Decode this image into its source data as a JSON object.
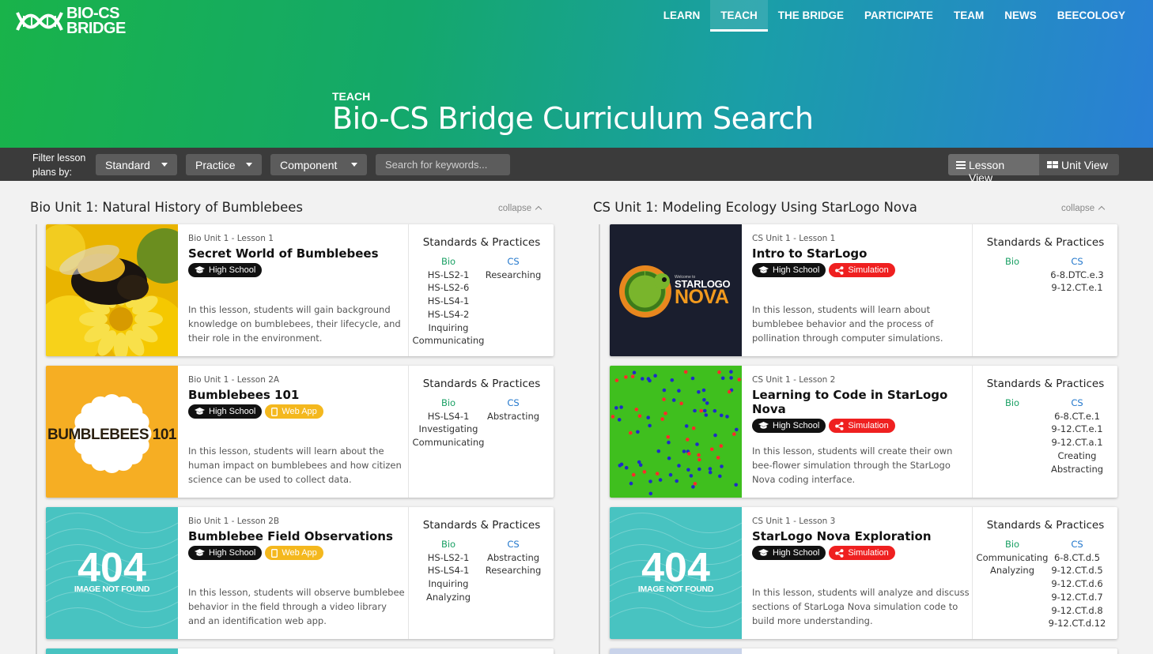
{
  "brand": {
    "logo_text_line1": "BIO-CS",
    "logo_text_line2": "BRIDGE"
  },
  "nav": [
    {
      "label": "LEARN",
      "active": false
    },
    {
      "label": "TEACH",
      "active": true
    },
    {
      "label": "THE BRIDGE",
      "active": false
    },
    {
      "label": "PARTICIPATE",
      "active": false
    },
    {
      "label": "TEAM",
      "active": false
    },
    {
      "label": "NEWS",
      "active": false
    },
    {
      "label": "BEECOLOGY",
      "active": false
    }
  ],
  "hero": {
    "kicker": "TEACH",
    "title": "Bio-CS Bridge Curriculum Search"
  },
  "filter": {
    "label_line1": "Filter lesson",
    "label_line2": "plans by:",
    "standard": "Standard",
    "practice": "Practice",
    "component": "Component",
    "search_placeholder": "Search for keywords...",
    "lesson_view": "Lesson View",
    "unit_view": "Unit View"
  },
  "columns": [
    {
      "heading": "Bio Unit 1: Natural History of Bumblebees",
      "collapse": "collapse",
      "cards": [
        {
          "image": "bumblebee-on-flower",
          "kicker": "Bio Unit 1 - Lesson 1",
          "title": "Secret World of Bumblebees",
          "badges": [
            {
              "label": "High School",
              "icon": "graduation-cap-icon"
            }
          ],
          "description": "In this lesson, students will gain background knowledge on bumblebees, their lifecycle, and their role in the environment.",
          "sp_title": "Standards & Practices",
          "bio_header": "Bio",
          "bio_items": [
            "HS-LS2-1",
            "HS-LS2-6",
            "HS-LS4-1",
            "HS-LS4-2",
            "Inquiring",
            "Communicating"
          ],
          "cs_header": "CS",
          "cs_items": [
            "Researching"
          ]
        },
        {
          "image": "bumblebees-101-logo",
          "image_text": "BUMBLEBEES 101",
          "kicker": "Bio Unit 1 - Lesson 2A",
          "title": "Bumblebees 101",
          "badges": [
            {
              "label": "High School",
              "icon": "graduation-cap-icon"
            },
            {
              "label": "Web App",
              "icon": "mobile-icon"
            }
          ],
          "description": "In this lesson, students will learn about the human impact on bumblebees and how citizen science can be used to collect data.",
          "sp_title": "Standards & Practices",
          "bio_header": "Bio",
          "bio_items": [
            "HS-LS4-1",
            "Investigating",
            "Communicating"
          ],
          "cs_header": "CS",
          "cs_items": [
            "Abstracting"
          ]
        },
        {
          "image": "image-not-found",
          "image_text_big": "404",
          "image_text_small": "IMAGE NOT FOUND",
          "kicker": "Bio Unit 1 - Lesson 2B",
          "title": "Bumblebee Field Observations",
          "badges": [
            {
              "label": "High School",
              "icon": "graduation-cap-icon"
            },
            {
              "label": "Web App",
              "icon": "mobile-icon"
            }
          ],
          "description": "In this lesson, students will observe bumblebee behavior in the field through a video library and an identification web app.",
          "sp_title": "Standards & Practices",
          "bio_header": "Bio",
          "bio_items": [
            "HS-LS2-1",
            "HS-LS4-1",
            "Inquiring",
            "Analyzing"
          ],
          "cs_header": "CS",
          "cs_items": [
            "Abstracting",
            "Researching"
          ]
        }
      ]
    },
    {
      "heading": "CS Unit 1: Modeling Ecology Using StarLogo Nova",
      "collapse": "collapse",
      "cards": [
        {
          "image": "starlogo-nova-logo",
          "image_text_small": "Welcome to",
          "image_text": "STARLOGO",
          "image_text_big": "NOVA",
          "kicker": "CS Unit 1 - Lesson 1",
          "title": "Intro to StarLogo",
          "badges": [
            {
              "label": "High School",
              "icon": "graduation-cap-icon"
            },
            {
              "label": "Simulation",
              "icon": "share-icon"
            }
          ],
          "description": "In this lesson, students will learn about bumblebee behavior and the process of pollination through computer simulations.",
          "sp_title": "Standards & Practices",
          "bio_header": "Bio",
          "bio_items": [],
          "cs_header": "CS",
          "cs_items": [
            "6-8.DTC.e.3",
            "9-12.CT.e.1"
          ]
        },
        {
          "image": "simulation-dots",
          "kicker": "CS Unit 1 - Lesson 2",
          "title": "Learning to Code in StarLogo Nova",
          "badges": [
            {
              "label": "High School",
              "icon": "graduation-cap-icon"
            },
            {
              "label": "Simulation",
              "icon": "share-icon"
            }
          ],
          "description": "In this lesson, students will create their own bee-flower simulation through the StarLogo Nova coding interface.",
          "sp_title": "Standards & Practices",
          "bio_header": "Bio",
          "bio_items": [],
          "cs_header": "CS",
          "cs_items": [
            "6-8.CT.e.1",
            "9-12.CT.e.1",
            "9-12.CT.a.1",
            "Creating",
            "Abstracting"
          ]
        },
        {
          "image": "image-not-found",
          "image_text_big": "404",
          "image_text_small": "IMAGE NOT FOUND",
          "kicker": "CS Unit 1 - Lesson 3",
          "title": "StarLogo Nova Exploration",
          "badges": [
            {
              "label": "High School",
              "icon": "graduation-cap-icon"
            },
            {
              "label": "Simulation",
              "icon": "share-icon"
            }
          ],
          "description": "In this lesson, students will analyze and discuss sections of StarLoga Nova simulation code to build more understanding.",
          "sp_title": "Standards & Practices",
          "bio_header": "Bio",
          "bio_items": [
            "Communicating",
            "Analyzing"
          ],
          "cs_header": "CS",
          "cs_items": [
            "6-8.CT.d.5",
            "9-12.CT.d.5",
            "9-12.CT.d.6",
            "9-12.CT.d.7",
            "9-12.CT.d.8",
            "9-12.CT.d.12"
          ]
        }
      ]
    }
  ],
  "colors": {
    "bio_green": "#1aa064",
    "cs_blue": "#2277cc",
    "sim_red": "#ef2020",
    "webapp_yellow": "#f4b81e",
    "teal_404": "#48c3c1"
  }
}
